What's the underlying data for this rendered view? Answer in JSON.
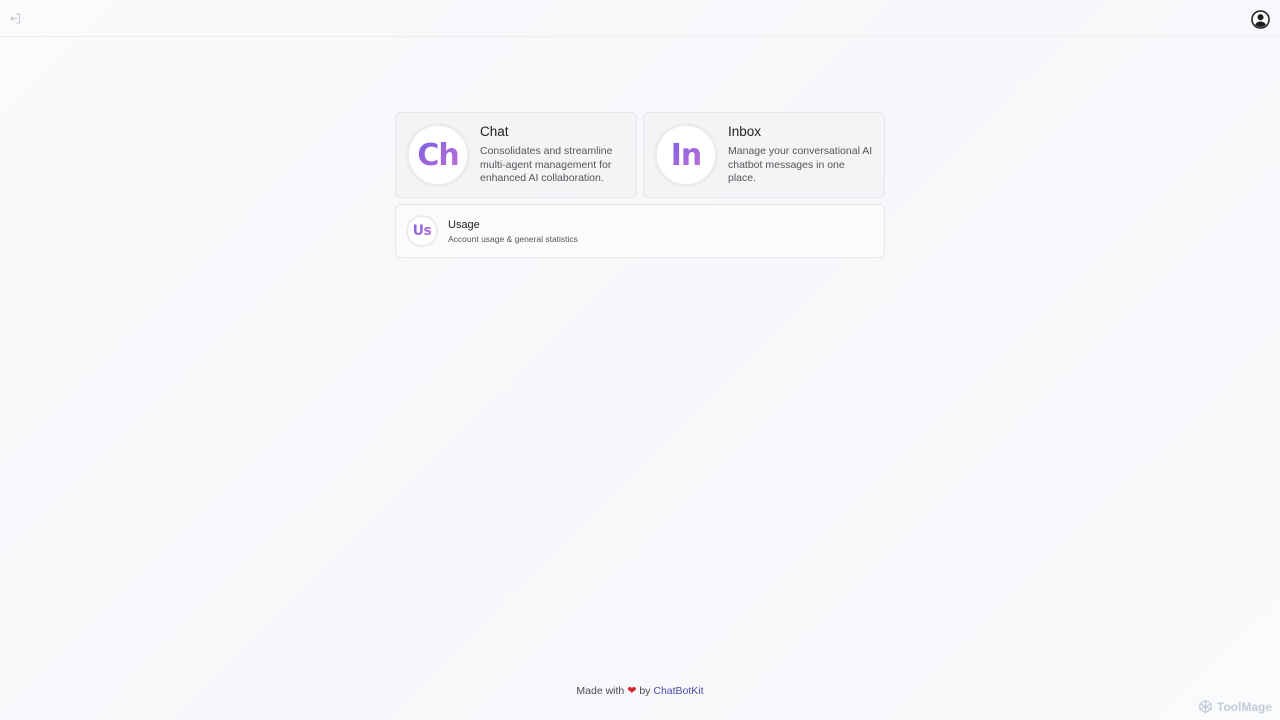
{
  "header": {
    "logout_icon": "logout-icon",
    "account_icon": "user-circle-icon"
  },
  "cards": [
    {
      "badge": "Ch",
      "title": "Chat",
      "description": "Consolidates and streamline multi-agent management for enhanced AI collaboration."
    },
    {
      "badge": "In",
      "title": "Inbox",
      "description": "Manage your conversational AI chatbot messages in one place."
    }
  ],
  "usage": {
    "badge": "Us",
    "title": "Usage",
    "description": "Account usage & general statistics"
  },
  "footer": {
    "prefix": "Made with",
    "heart": "❤",
    "by": "by",
    "brand": "ChatBotKit"
  },
  "watermark": {
    "text": "ToolMage"
  },
  "colors": {
    "badge_gradient_start": "#7c5fe0",
    "badge_gradient_end": "#c070d8",
    "heart": "#d9232e",
    "brand_link": "#4b4aa8"
  }
}
